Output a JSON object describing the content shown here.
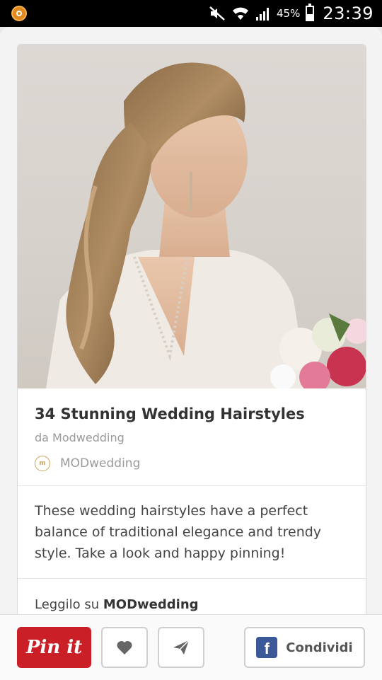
{
  "status_bar": {
    "battery_text": "45%",
    "time": "23:39",
    "battery_level": 0.45
  },
  "pin": {
    "title": "34 Stunning Wedding Hairstyles",
    "source": "da Modwedding",
    "board_logo_text": "m",
    "board_name": "MODwedding",
    "description": "These wedding hairstyles have a perfect balance of traditional elegance and trendy style. Take a look and happy pinning!",
    "read_prefix": "Leggilo su ",
    "read_site": "MODwedding"
  },
  "actions": {
    "pin_label": "Pin it",
    "share_label": "Condividi",
    "facebook_glyph": "f"
  },
  "icons": [
    "app-notification-icon",
    "mute-icon",
    "wifi-icon",
    "signal-icon",
    "battery-icon",
    "heart-icon",
    "send-icon",
    "facebook-icon"
  ],
  "colors": {
    "pin_red": "#cb1f27",
    "facebook_blue": "#3b5998",
    "accent_gold": "#c9a45c"
  }
}
